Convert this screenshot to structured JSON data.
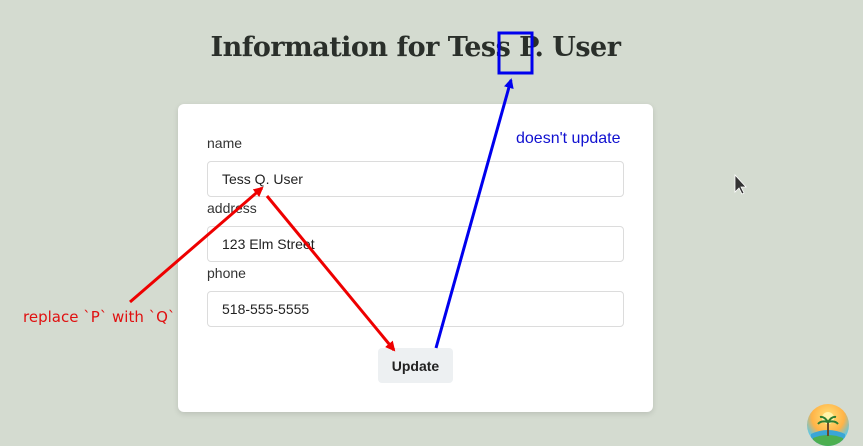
{
  "page": {
    "title": "Information for Tess P. User"
  },
  "form": {
    "name": {
      "label": "name",
      "value": "Tess Q. User"
    },
    "address": {
      "label": "address",
      "value": "123 Elm Street"
    },
    "phone": {
      "label": "phone",
      "value": "518-555-5555"
    },
    "update_label": "Update"
  },
  "annotations": {
    "blue_note": "doesn't update",
    "red_note": "replace `P` with `Q`",
    "blue_color": "#0000ee",
    "red_color": "#ee0000"
  },
  "icons": {
    "cursor": "mouse-pointer-icon",
    "logo": "app-logo-icon"
  }
}
